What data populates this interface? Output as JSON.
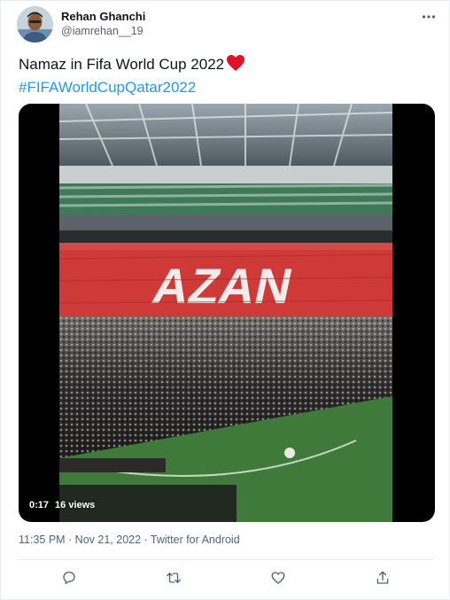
{
  "user": {
    "name": "Rehan Ghanchi",
    "handle": "@iamrehan__19"
  },
  "tweet": {
    "text": "Namaz in Fifa World Cup 2022",
    "hashtag": "#FIFAWorldCupQatar2022",
    "emoji_icon": "red-heart-icon"
  },
  "media": {
    "duration": "0:17",
    "views": "16 views",
    "stadium_banner": "AZAN"
  },
  "meta": {
    "timestamp": "11:35 PM · Nov 21, 2022 · Twitter for Android"
  },
  "actions": {
    "reply_icon": "reply-icon",
    "retweet_icon": "retweet-icon",
    "like_icon": "like-icon",
    "share_icon": "share-icon"
  },
  "colors": {
    "accent": "#1d9bf0",
    "text_secondary": "#536471",
    "divider": "#e6ecf0"
  }
}
